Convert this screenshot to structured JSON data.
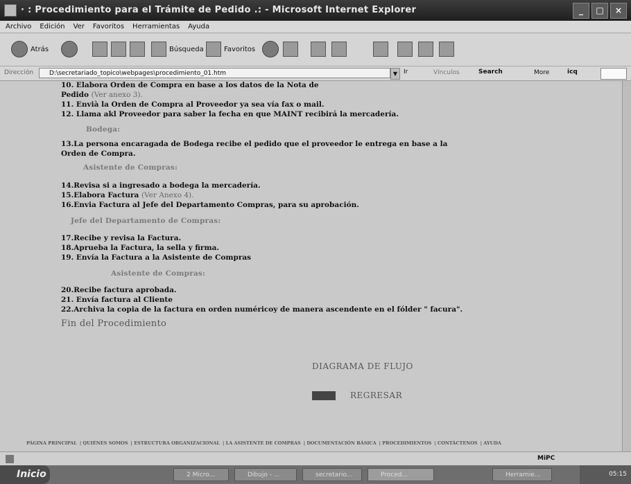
{
  "window": {
    "title": "· : Procedimiento para el Trámite de Pedido .: - Microsoft Internet Explorer"
  },
  "menu": [
    "Archivo",
    "Edición",
    "Ver",
    "Favoritos",
    "Herramientas",
    "Ayuda"
  ],
  "toolbar": {
    "back_label": "Atrás",
    "search_label": "Búsqueda",
    "favorites_label": "Favoritos"
  },
  "address": {
    "label": "Dirección",
    "value": "D:\\secretariado_topico\\webpages\\procedimiento_01.htm",
    "go_label": "Ir",
    "links_label": "Vínculos",
    "search_label": "Search",
    "more_label": "More",
    "icq_label": "icq"
  },
  "content": {
    "lines1": [
      "10. Elabora Orden de Compra en base a los datos de la Nota de",
      "Pedido",
      "(Ver anexo 3).",
      "11. Envià la Orden de Compra al Proveedor ya sea vía fax o mail.",
      "12. Llama akl Proveedor para saber la fecha en que MAINT recibirá la mercadería."
    ],
    "heading_bodega": "Bodega:",
    "lines2": [
      "13.La persona encaragada de Bodega recibe el pedido que el proveedor le entrega en base a la",
      "Orden de Compra."
    ],
    "heading_asistente1": "Asistente de Compras:",
    "lines3": [
      "14.Revisa si a ingresado a bodega la mercadería.",
      "15.Elabora Factura",
      "(Ver Anexo 4).",
      "16.Envia Factura al Jefe del Departamento Compras, para su aprobación."
    ],
    "heading_jefe": "Jefe del Departamento de Compras:",
    "lines4": [
      "17.Recibe y revisa la Factura.",
      "18.Aprueba la Factura, la sella y firma.",
      "19. Envía la Factura a la Asistente de Compras"
    ],
    "heading_asistente2": "Asistente de Compras:",
    "lines5": [
      "20.Recibe factura aprobada.",
      "21. Envía factura al Cliente",
      "22.Archiva la copia de la factura en orden numéricoy de manera ascendente en el fólder \" facura\"."
    ],
    "fin": "Fin del Procedimiento",
    "diagram_link": "DIAGRAMA DE FLUJO",
    "back_link": "REGRESAR",
    "footer_links": [
      "PÁGINA PRINCIPAL",
      "QUIÉNES SOMOS",
      "ESTRUCTURA ORGANIZACIONAL",
      "LA ASISTENTE DE COMPRAS",
      "DOCUMENTACIÓN BÁSICA",
      "PROCEDIMIENTOS",
      "CONTÁCTENOS",
      "AYUDA"
    ]
  },
  "status": {
    "zone": "MiPC"
  },
  "taskbar": {
    "start": "Inicio",
    "tasks": [
      "2 Micro...",
      "Dibujo - ...",
      "secretario...",
      "Proced...",
      "Herramie..."
    ],
    "clock": "05:15"
  }
}
